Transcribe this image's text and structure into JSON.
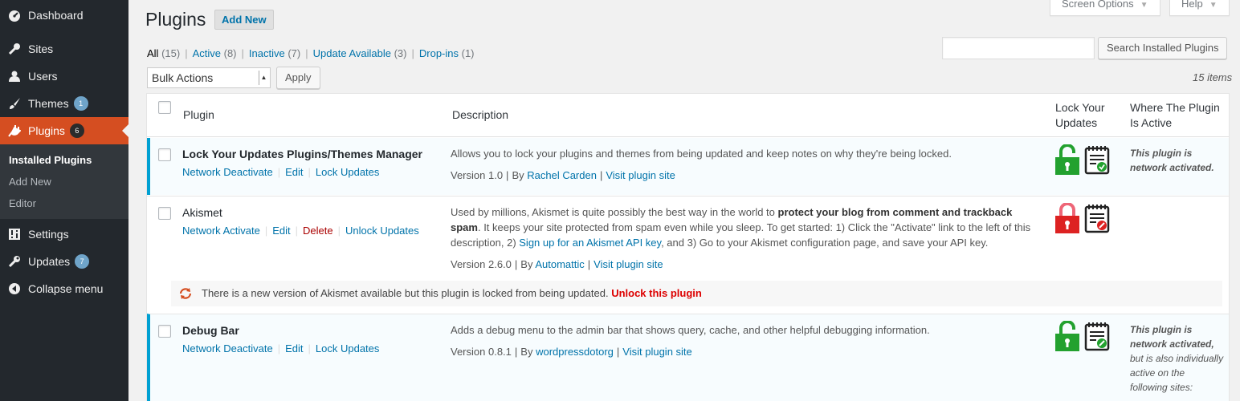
{
  "sidebar": {
    "items": [
      {
        "label": "Dashboard",
        "icon": "dashboard-icon"
      },
      {
        "label": "Sites",
        "icon": "wrench-icon"
      },
      {
        "label": "Users",
        "icon": "user-icon"
      },
      {
        "label": "Themes",
        "icon": "brush-icon",
        "count": "1"
      },
      {
        "label": "Plugins",
        "icon": "plugin-icon",
        "count": "6"
      },
      {
        "label": "Settings",
        "icon": "settings-icon"
      },
      {
        "label": "Updates",
        "icon": "wrench-icon",
        "count": "7"
      },
      {
        "label": "Collapse menu",
        "icon": "collapse-icon"
      }
    ],
    "submenu": [
      "Installed Plugins",
      "Add New",
      "Editor"
    ]
  },
  "header": {
    "title": "Plugins",
    "add_new": "Add New",
    "screen_options": "Screen Options",
    "help": "Help"
  },
  "filters": {
    "all": {
      "label": "All",
      "count": "(15)"
    },
    "active": {
      "label": "Active",
      "count": "(8)"
    },
    "inactive": {
      "label": "Inactive",
      "count": "(7)"
    },
    "update": {
      "label": "Update Available",
      "count": "(3)"
    },
    "dropins": {
      "label": "Drop-ins",
      "count": "(1)"
    }
  },
  "search": {
    "button": "Search Installed Plugins",
    "value": ""
  },
  "bulk": {
    "selected": "Bulk Actions",
    "apply": "Apply",
    "items": "15 items"
  },
  "columns": {
    "plugin": "Plugin",
    "description": "Description",
    "lock": "Lock Your Updates",
    "where": "Where The Plugin Is Active"
  },
  "plugins": [
    {
      "name": "Lock Your Updates Plugins/Themes Manager",
      "actions": [
        "Network Deactivate",
        "Edit",
        "Lock Updates"
      ],
      "description": "Allows you to lock your plugins and themes from being updated and keep notes on why they're being locked.",
      "version": "Version 1.0",
      "by": "By",
      "author": "Rachel Carden",
      "site": "Visit plugin site",
      "where": "This plugin is network activated."
    },
    {
      "name": "Akismet",
      "actions": [
        "Network Activate",
        "Edit",
        "Delete",
        "Unlock Updates"
      ],
      "description_pre": "Used by millions, Akismet is quite possibly the best way in the world to ",
      "description_bold": "protect your blog from comment and trackback spam",
      "description_mid": ". It keeps your site protected from spam even while you sleep. To get started: 1) Click the \"Activate\" link to the left of this description, 2) ",
      "description_link": "Sign up for an Akismet API key",
      "description_post": ", and 3) Go to your Akismet configuration page, and save your API key.",
      "version": "Version 2.6.0",
      "by": "By",
      "author": "Automattic",
      "site": "Visit plugin site",
      "update_msg": "There is a new version of Akismet available but this plugin is locked from being updated.",
      "unlock": "Unlock this plugin"
    },
    {
      "name": "Debug Bar",
      "actions": [
        "Network Deactivate",
        "Edit",
        "Lock Updates"
      ],
      "description": "Adds a debug menu to the admin bar that shows query, cache, and other helpful debugging information.",
      "version": "Version 0.8.1",
      "by": "By",
      "author": "wordpressdotorg",
      "site": "Visit plugin site",
      "where_bold": "This plugin is network activated,",
      "where_rest": "but is also individually active on the following sites:"
    }
  ],
  "colors": {
    "sidebar_bg": "#23282d",
    "current_menu": "#d54e21",
    "link": "#0073aa",
    "active_border": "#00a0d2",
    "lock_green": "#23a12f",
    "lock_red": "#dd2222"
  }
}
